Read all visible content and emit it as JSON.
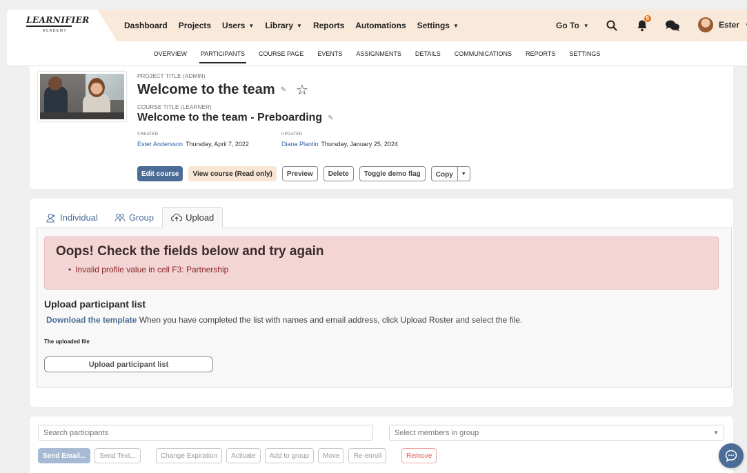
{
  "brand": {
    "name": "LEARNIFIER",
    "sub": "ACADEMY"
  },
  "nav": [
    {
      "label": "Dashboard",
      "dropdown": false
    },
    {
      "label": "Projects",
      "dropdown": false
    },
    {
      "label": "Users",
      "dropdown": true
    },
    {
      "label": "Library",
      "dropdown": true
    },
    {
      "label": "Reports",
      "dropdown": false
    },
    {
      "label": "Automations",
      "dropdown": false
    },
    {
      "label": "Settings",
      "dropdown": true
    }
  ],
  "header": {
    "goto_label": "Go To",
    "notification_count": "5",
    "user_name": "Ester",
    "icons": [
      "search-icon",
      "bell-icon",
      "chat-bubbles-icon"
    ]
  },
  "subnav": {
    "items": [
      "OVERVIEW",
      "PARTICIPANTS",
      "COURSE PAGE",
      "EVENTS",
      "ASSIGNMENTS",
      "DETAILS",
      "COMMUNICATIONS",
      "REPORTS",
      "SETTINGS"
    ],
    "active": "PARTICIPANTS"
  },
  "project": {
    "project_title_label": "PROJECT TITLE (ADMIN)",
    "project_title": "Welcome to the team",
    "course_title_label": "COURSE TITLE (LEARNER)",
    "course_title": "Welcome to the team - Preboarding",
    "created_label": "CREATED",
    "created_by": "Ester Andersson",
    "created_date": "Thursday, April 7, 2022",
    "updated_label": "UPDATED",
    "updated_by": "Diana Plantin",
    "updated_date": "Thursday, January 25, 2024",
    "buttons": {
      "edit": "Edit course",
      "view": "View course (Read only)",
      "preview": "Preview",
      "delete": "Delete",
      "toggle_demo": "Toggle demo flag",
      "copy": "Copy"
    }
  },
  "upload": {
    "tabs": [
      {
        "label": "Individual",
        "icon": "add-user-icon"
      },
      {
        "label": "Group",
        "icon": "group-icon"
      },
      {
        "label": "Upload",
        "icon": "cloud-upload-icon"
      }
    ],
    "active_tab": "Upload",
    "error_title": "Oops! Check the fields below and try again",
    "errors": [
      "Invalid profile value in cell F3: Partnership"
    ],
    "section_title": "Upload participant list",
    "template_link": "Download the template",
    "instruction": "When you have completed the list with names and email address, click Upload Roster and select the file.",
    "file_label": "The uploaded file",
    "upload_button": "Upload participant list"
  },
  "participants": {
    "search_placeholder": "Search participants",
    "select_placeholder": "Select members in group",
    "actions": [
      "Send Email...",
      "Send Text...",
      "Change Expiration",
      "Activate",
      "Add to group",
      "Move",
      "Re-enroll",
      "Remove"
    ]
  },
  "colors": {
    "header_bg": "#f9e9da",
    "primary": "#4a6c96",
    "error_bg": "#f3d5d5",
    "error_text": "#8a2424",
    "danger": "#e25b5b"
  }
}
